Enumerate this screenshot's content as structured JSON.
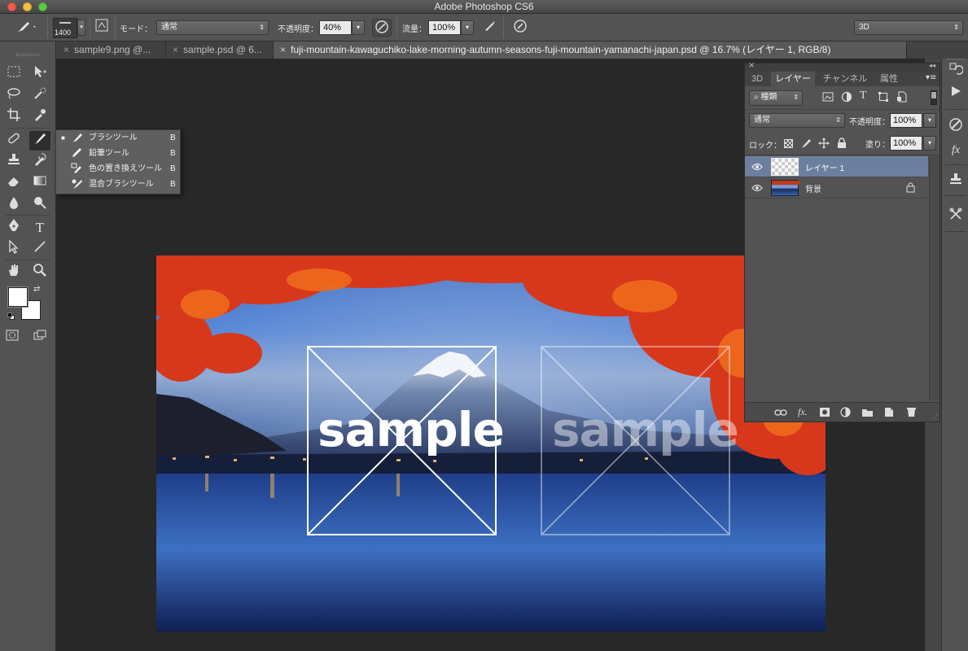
{
  "window": {
    "title": "Adobe Photoshop CS6"
  },
  "options": {
    "brush_size": "1400",
    "mode_label": "モード：",
    "mode_value": "通常",
    "opacity_label": "不透明度：",
    "opacity_value": "40%",
    "flow_label": "流量：",
    "flow_value": "100%",
    "workspace_value": "3D"
  },
  "tabs": [
    {
      "label": "sample9.png @..."
    },
    {
      "label": "sample.psd @ 6..."
    },
    {
      "label": "fuji-mountain-kawaguchiko-lake-morning-autumn-seasons-fuji-mountain-yamanachi-japan.psd @ 16.7% (レイヤー 1, RGB/8)"
    }
  ],
  "flyout": {
    "items": [
      {
        "label": "ブラシツール",
        "shortcut": "B",
        "active": true
      },
      {
        "label": "鉛筆ツール",
        "shortcut": "B"
      },
      {
        "label": "色の置き換えツール",
        "shortcut": "B"
      },
      {
        "label": "混合ブラシツール",
        "shortcut": "B"
      }
    ]
  },
  "panel": {
    "tabs": [
      {
        "label": "3D"
      },
      {
        "label": "レイヤー"
      },
      {
        "label": "チャンネル"
      },
      {
        "label": "属性"
      }
    ],
    "filter_label": "種類",
    "blend_value": "通常",
    "opacity_label": "不透明度：",
    "opacity_value": "100%",
    "lock_label": "ロック：",
    "fill_label": "塗り：",
    "fill_value": "100%",
    "layers": [
      {
        "name": "レイヤー 1",
        "selected": true
      },
      {
        "name": "背景",
        "locked": true
      }
    ]
  },
  "canvas": {
    "watermark_text": "sample"
  },
  "colors": {
    "accent": "#6d7f9e",
    "chrome": "#535353",
    "workspace": "#282828"
  }
}
